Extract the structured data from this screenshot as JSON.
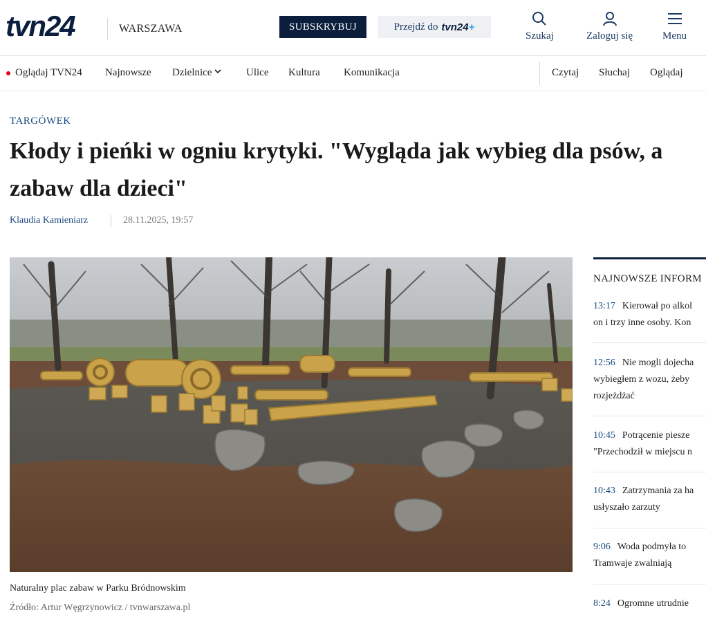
{
  "header": {
    "logo": "tvn24",
    "city": "WARSZAWA",
    "subscribe_label": "SUBSKRYBUJ",
    "goto_label": "Przejdź do",
    "goto_logo": "tvn24",
    "goto_logo_plus": "+",
    "search_label": "Szukaj",
    "login_label": "Zaloguj się",
    "menu_label": "Menu"
  },
  "nav": {
    "live_label": "Oglądaj TVN24",
    "left_items": [
      "Najnowsze",
      "Dzielnice",
      "Ulice",
      "Kultura",
      "Komunikacja"
    ],
    "right_items": [
      "Czytaj",
      "Słuchaj",
      "Oglądaj"
    ],
    "accent_color": "#e4001b"
  },
  "article": {
    "section": "TARGÓWEK",
    "title_line1": "Kłody i pieńki w ogniu krytyki. \"Wygląda jak wybieg dla psów, a",
    "title_line2": "zabaw dla dzieci\"",
    "author": "Klaudia Kamieniarz",
    "date": "28.11.2025, 19:57",
    "caption": "Naturalny plac zabaw w Parku Bródnowskim",
    "source": "Źródło: Artur Węgrzynowicz / tvnwarszawa.pl"
  },
  "sidebar": {
    "title": "NAJNOWSZE INFORM",
    "items": [
      {
        "time": "13:17",
        "line1": "Kierował po alkol",
        "line2": "on i trzy inne osoby. Kon"
      },
      {
        "time": "12:56",
        "line1": "Nie mogli dojecha",
        "line2": "wybiegłem z wozu, żeby",
        "line3": "rozjeżdżać"
      },
      {
        "time": "10:45",
        "line1": "Potrącenie piesze",
        "line2": "\"Przechodził w miejscu n"
      },
      {
        "time": "10:43",
        "line1": "Zatrzymania za ha",
        "line2": "usłyszało zarzuty"
      },
      {
        "time": "9:06",
        "line1": "Woda podmyła to",
        "line2": "Tramwaje zwalniają"
      },
      {
        "time": "8:24",
        "line1": "Ogromne utrudnie"
      }
    ]
  },
  "colors": {
    "brand_navy": "#0b1f3d",
    "link_blue": "#1a4a82",
    "plus_blue": "#2aa1e6"
  }
}
